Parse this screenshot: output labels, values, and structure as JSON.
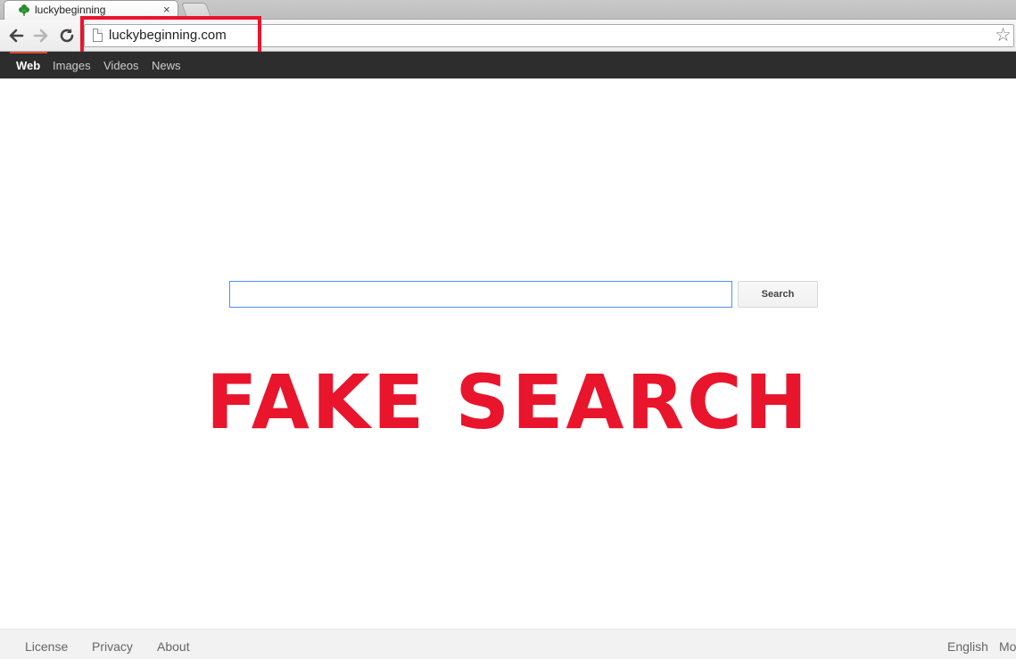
{
  "browser": {
    "tab_title": "luckybeginning",
    "tab_close": "×",
    "url": "luckybeginning.com"
  },
  "site_nav": {
    "items": [
      {
        "label": "Web",
        "active": true
      },
      {
        "label": "Images",
        "active": false
      },
      {
        "label": "Videos",
        "active": false
      },
      {
        "label": "News",
        "active": false
      }
    ]
  },
  "search": {
    "value": "",
    "button_label": "Search"
  },
  "overlay_label": "FAKE SEARCH",
  "footer": {
    "links": [
      "License",
      "Privacy",
      "About"
    ],
    "right_links": [
      "English",
      "Mo"
    ]
  },
  "colors": {
    "highlight_red": "#e8152c",
    "nav_bar": "#2d2d2d",
    "input_focus_border": "#4d90fe"
  },
  "icons": [
    "clover-favicon-icon",
    "back-arrow-icon",
    "forward-arrow-icon",
    "reload-icon",
    "page-icon",
    "star-icon"
  ]
}
